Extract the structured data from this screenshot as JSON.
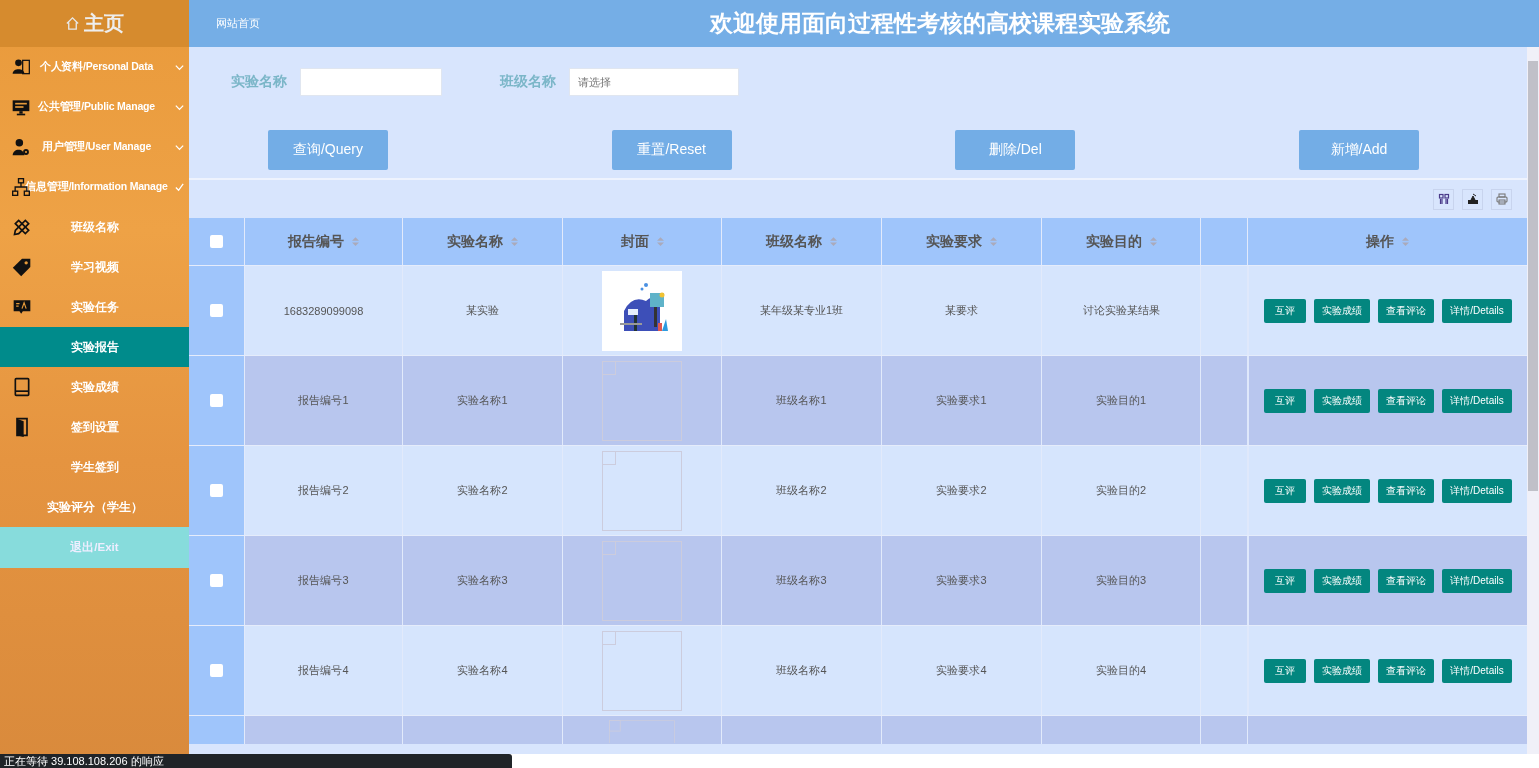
{
  "sidebar": {
    "title": "主页",
    "menus": [
      {
        "label": "个人资料/Personal Data",
        "expanded": false
      },
      {
        "label": "公共管理/Public Manage",
        "expanded": false
      },
      {
        "label": "用户管理/User Manage",
        "expanded": false
      },
      {
        "label": "信息管理/Information Manage",
        "expanded": true,
        "children": [
          {
            "label": "班级名称",
            "selected": false
          },
          {
            "label": "学习视频",
            "selected": false
          },
          {
            "label": "实验任务",
            "selected": false
          },
          {
            "label": "实验报告",
            "selected": true
          },
          {
            "label": "实验成绩",
            "selected": false
          },
          {
            "label": "签到设置",
            "selected": false
          },
          {
            "label": "学生签到",
            "selected": false
          },
          {
            "label": "实验评分（学生）",
            "selected": false
          }
        ]
      }
    ],
    "exit": "退出/Exit"
  },
  "header": {
    "breadcrumb": "网站首页",
    "title": "欢迎使用面向过程性考核的高校课程实验系统"
  },
  "filters": [
    {
      "label": "实验名称"
    },
    {
      "label": "班级名称",
      "placeholder": "请选择"
    }
  ],
  "buttons": [
    "查询/Query",
    "重置/Reset",
    "删除/Del",
    "新增/Add"
  ],
  "table": {
    "select_all": false,
    "columns": [
      "报告编号",
      "实验名称",
      "封面",
      "班级名称",
      "实验要求",
      "实验目的",
      "操作"
    ],
    "rows": [
      {
        "checked": false,
        "cells": [
          "1683289099098",
          "某实验",
          {
            "kind": "picture"
          },
          "某年级某专业1班",
          "某要求",
          "讨论实验某结果"
        ],
        "actions": [
          "互评",
          "实验成绩",
          "查看评论",
          "详情/Details"
        ]
      },
      {
        "checked": false,
        "cells": [
          "报告编号1",
          "实验名称1",
          {
            "kind": "broken"
          },
          "班级名称1",
          "实验要求1",
          "实验目的1"
        ],
        "actions": [
          "互评",
          "实验成绩",
          "查看评论",
          "详情/Details"
        ]
      },
      {
        "checked": false,
        "cells": [
          "报告编号2",
          "实验名称2",
          {
            "kind": "broken"
          },
          "班级名称2",
          "实验要求2",
          "实验目的2"
        ],
        "actions": [
          "互评",
          "实验成绩",
          "查看评论",
          "详情/Details"
        ]
      },
      {
        "checked": false,
        "cells": [
          "报告编号3",
          "实验名称3",
          {
            "kind": "broken"
          },
          "班级名称3",
          "实验要求3",
          "实验目的3"
        ],
        "actions": [
          "互评",
          "实验成绩",
          "查看评论",
          "详情/Details"
        ]
      },
      {
        "checked": false,
        "cells": [
          "报告编号4",
          "实验名称4",
          {
            "kind": "broken"
          },
          "班级名称4",
          "实验要求4",
          "实验目的4"
        ],
        "actions": [
          "互评",
          "实验成绩",
          "查看评论",
          "详情/Details"
        ]
      }
    ],
    "partial_row": {
      "cover": {
        "kind": "broken"
      }
    }
  },
  "status_bar": "正在等待 39.108.108.206 的响应"
}
